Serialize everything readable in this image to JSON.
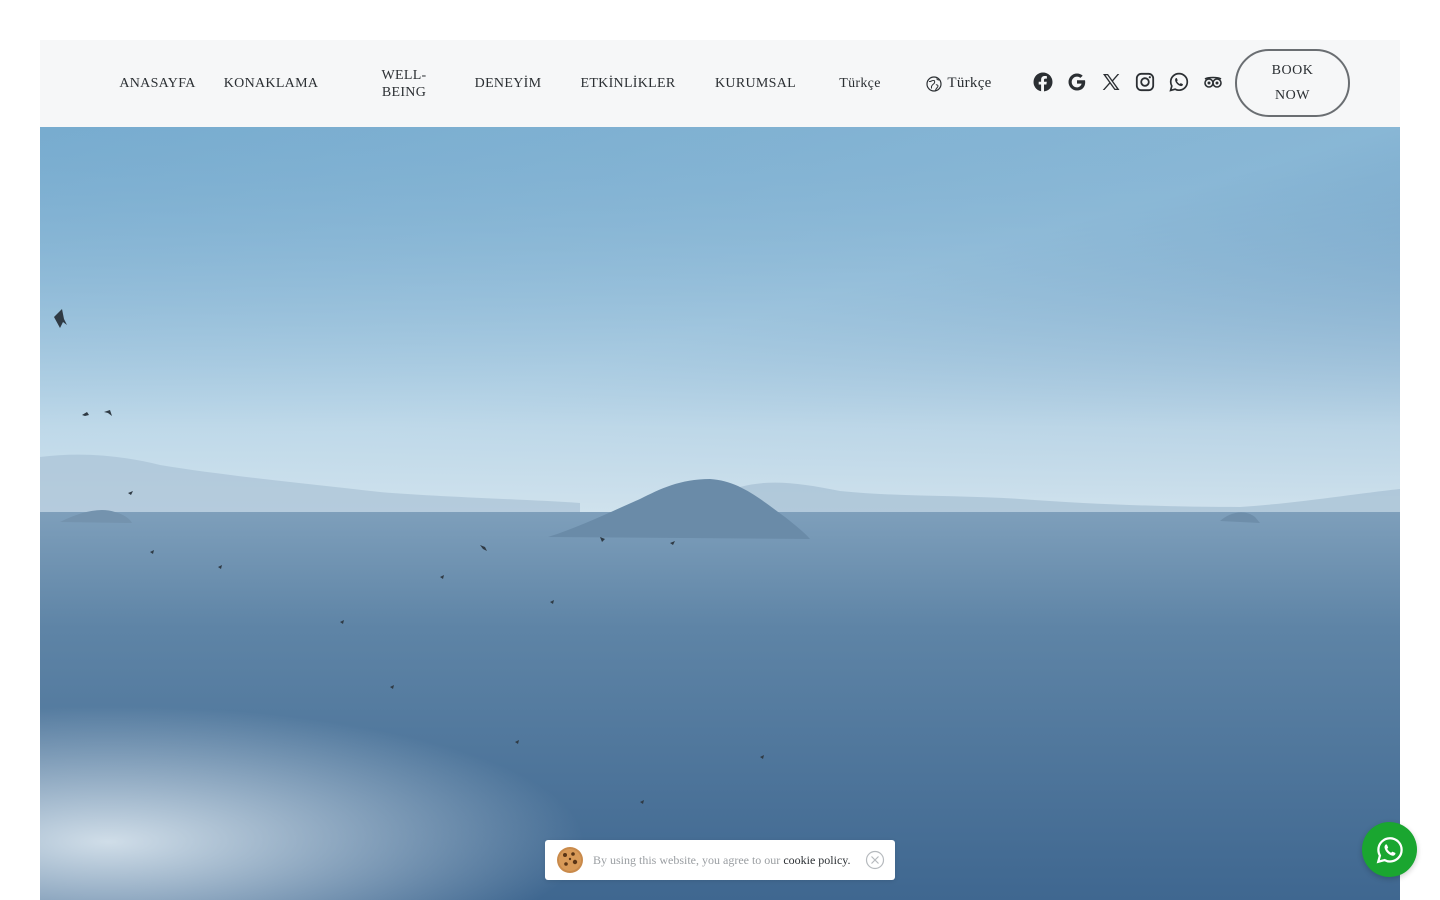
{
  "nav": {
    "items": [
      {
        "label": "ANASAYFA"
      },
      {
        "label": "KONAKLAMA"
      },
      {
        "label": "WELL-BEING"
      },
      {
        "label": "DENEYİM"
      },
      {
        "label": "ETKİNLİKLER"
      },
      {
        "label": "KURUMSAL"
      }
    ],
    "well_line1": "WELL-",
    "well_line2": "BEING",
    "lang_text": "Türkçe",
    "lang_switch_text": "Türkçe",
    "socials": [
      "facebook-icon",
      "google-icon",
      "x-icon",
      "instagram-icon",
      "whatsapp-icon",
      "tripadvisor-icon"
    ],
    "book_line1": "BOOK",
    "book_line2": "NOW"
  },
  "cookie": {
    "text": "By using this website, you agree to our",
    "link": "cookie policy."
  },
  "colors": {
    "nav_bg": "#f6f7f8",
    "text": "#2b2f33",
    "whatsapp_green": "#1aa630"
  }
}
